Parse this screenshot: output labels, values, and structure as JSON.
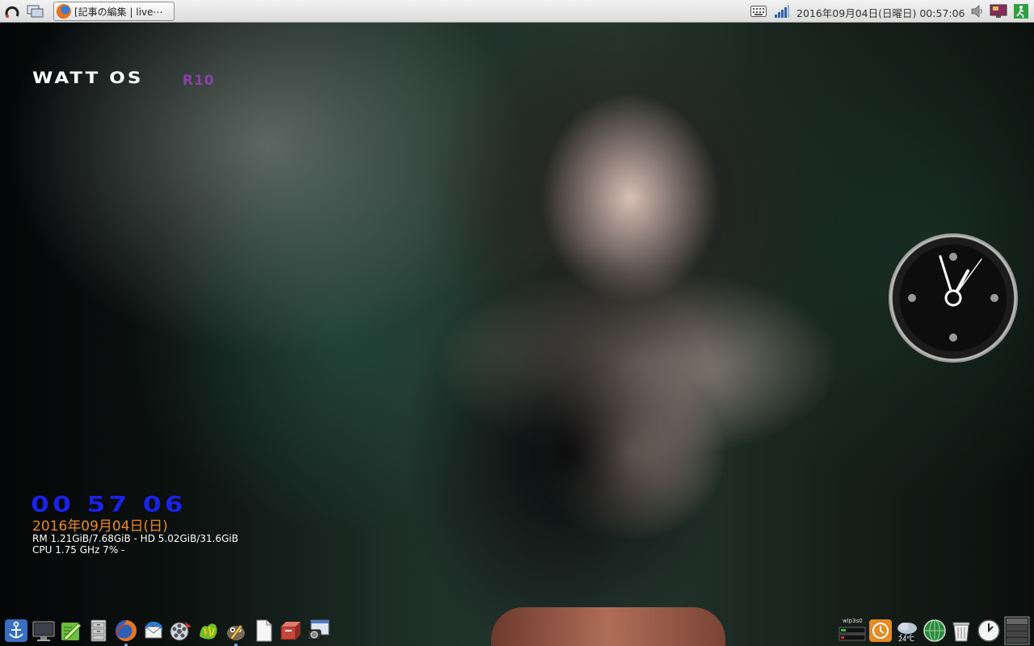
{
  "top_panel": {
    "taskbar_window_title": "[記事の編集 | live⋯",
    "clock": "2016年09月04日(日曜日) 00:57:06",
    "icons": [
      "launcher-icon",
      "show-desktop-icon",
      "keyboard-icon",
      "network-signal-icon",
      "volume-icon",
      "display-icon",
      "logout-icon"
    ]
  },
  "desktop": {
    "logo_text": "WATT OS",
    "logo_release": "R10",
    "conky": {
      "time": "00 57 06",
      "date": "2016年09月04日(日)",
      "memory_line": "RM 1.21GiB/7.68GiB - HD 5.02GiB/31.6GiB",
      "cpu_line": "CPU 1.75 GHz 7% -"
    },
    "analog_clock": {
      "hour": 0,
      "minute": 57,
      "second": 6
    }
  },
  "dock": {
    "launchers": [
      "anchor-icon",
      "monitor-icon",
      "text-editor-icon",
      "file-cabinet-icon",
      "firefox-icon",
      "thunderbird-icon",
      "media-player-icon",
      "game-icon",
      "gimp-icon",
      "document-icon",
      "software-center-icon",
      "screenshot-icon"
    ],
    "running": [
      "firefox-icon"
    ],
    "tray": {
      "wlan_label": "wlp3s0",
      "weather_temp": "24°C",
      "icons": [
        "network-meter-icon",
        "timer-icon",
        "weather-icon",
        "globe-icon",
        "trash-icon",
        "clock-icon",
        "workspace-switcher-icon"
      ]
    }
  },
  "colors": {
    "conky_time": "#1a22e6",
    "conky_date": "#f08a1c",
    "logo_release": "#8e3fa8"
  }
}
